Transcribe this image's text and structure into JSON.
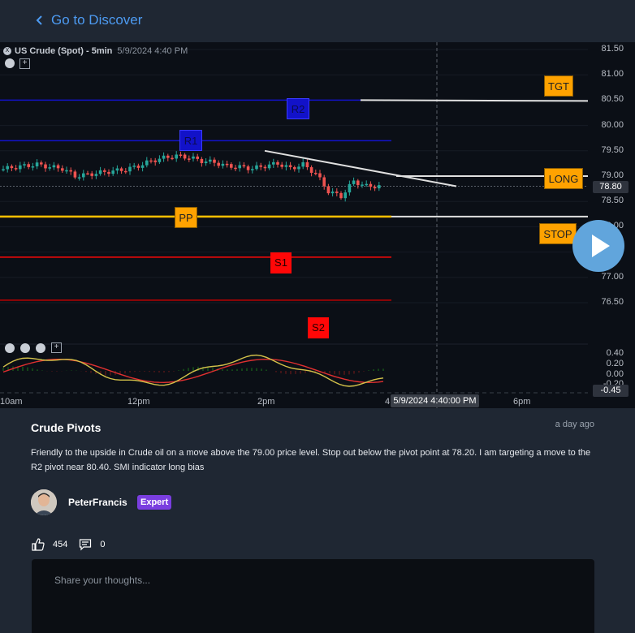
{
  "nav": {
    "back_label": "Go to Discover"
  },
  "chart": {
    "symbol": "US Crude (Spot) - 5min",
    "timestamp": "5/9/2024 4:40 PM",
    "last_price": "78.80",
    "indicator_value": "-0.45",
    "crosshair_time": "5/9/2024 4:40:00 PM",
    "levels": {
      "r2": "R2",
      "r1": "R1",
      "pp": "PP",
      "s1": "S1",
      "s2": "S2",
      "tgt": "TGT",
      "long": "LONG",
      "stop": "STOP"
    },
    "colors": {
      "r": "#1212c9",
      "pp": "#ffc000",
      "s": "#ff0707",
      "annotation": "#ffa200",
      "bull": "#26a69a",
      "bear": "#ef5350"
    }
  },
  "chart_data": {
    "type": "line",
    "title": "US Crude (Spot) - 5min",
    "x_ticks": [
      "10am",
      "12pm",
      "2pm",
      "4",
      "6pm"
    ],
    "y_ticks": [
      "81.50",
      "81.00",
      "80.50",
      "80.00",
      "79.50",
      "79.00",
      "78.50",
      "78.00",
      "77.50",
      "77.00",
      "76.50"
    ],
    "ylim": [
      76.2,
      81.6
    ],
    "indicator_ticks": [
      "0.40",
      "0.20",
      "0.00",
      "-0.20"
    ],
    "price_x": [
      "9:30",
      "9:45",
      "10:00",
      "10:15",
      "10:30",
      "10:45",
      "11:00",
      "11:15",
      "11:30",
      "11:45",
      "12:00",
      "12:15",
      "12:30",
      "12:45",
      "13:00",
      "13:15",
      "13:30",
      "13:45",
      "14:00",
      "14:15",
      "14:30",
      "14:45",
      "15:00",
      "15:15",
      "15:30",
      "15:45",
      "16:00",
      "16:10",
      "16:20",
      "16:30",
      "16:40"
    ],
    "price_close": [
      79.12,
      79.17,
      79.2,
      79.23,
      79.18,
      79.15,
      79.0,
      79.03,
      79.07,
      79.1,
      79.13,
      79.2,
      79.3,
      79.36,
      79.4,
      79.37,
      79.3,
      79.27,
      79.2,
      79.18,
      79.15,
      79.2,
      79.25,
      79.15,
      79.23,
      79.05,
      78.7,
      78.6,
      78.9,
      78.8,
      78.8
    ],
    "levels": [
      {
        "name": "R2",
        "value": 80.5
      },
      {
        "name": "R1",
        "value": 79.7
      },
      {
        "name": "PP",
        "value": 78.2
      },
      {
        "name": "S1",
        "value": 77.4
      },
      {
        "name": "S2",
        "value": 76.55
      }
    ],
    "annotations": [
      {
        "name": "TGT",
        "value": 80.5
      },
      {
        "name": "LONG",
        "value": 79.0
      },
      {
        "name": "STOP",
        "value": 78.2
      }
    ],
    "indicator": "SMI"
  },
  "post": {
    "title": "Crude Pivots",
    "time": "a day ago",
    "body": "Friendly to the upside in Crude oil on a move above the 79.00 price level. Stop out below the pivot point at 78.20. I am targeting a move to the R2 pivot near 80.40. SMI indicator long bias",
    "author": "PeterFrancis",
    "role": "Expert",
    "likes": "454",
    "comments": "0"
  },
  "comment_input": {
    "placeholder": "Share your thoughts..."
  }
}
